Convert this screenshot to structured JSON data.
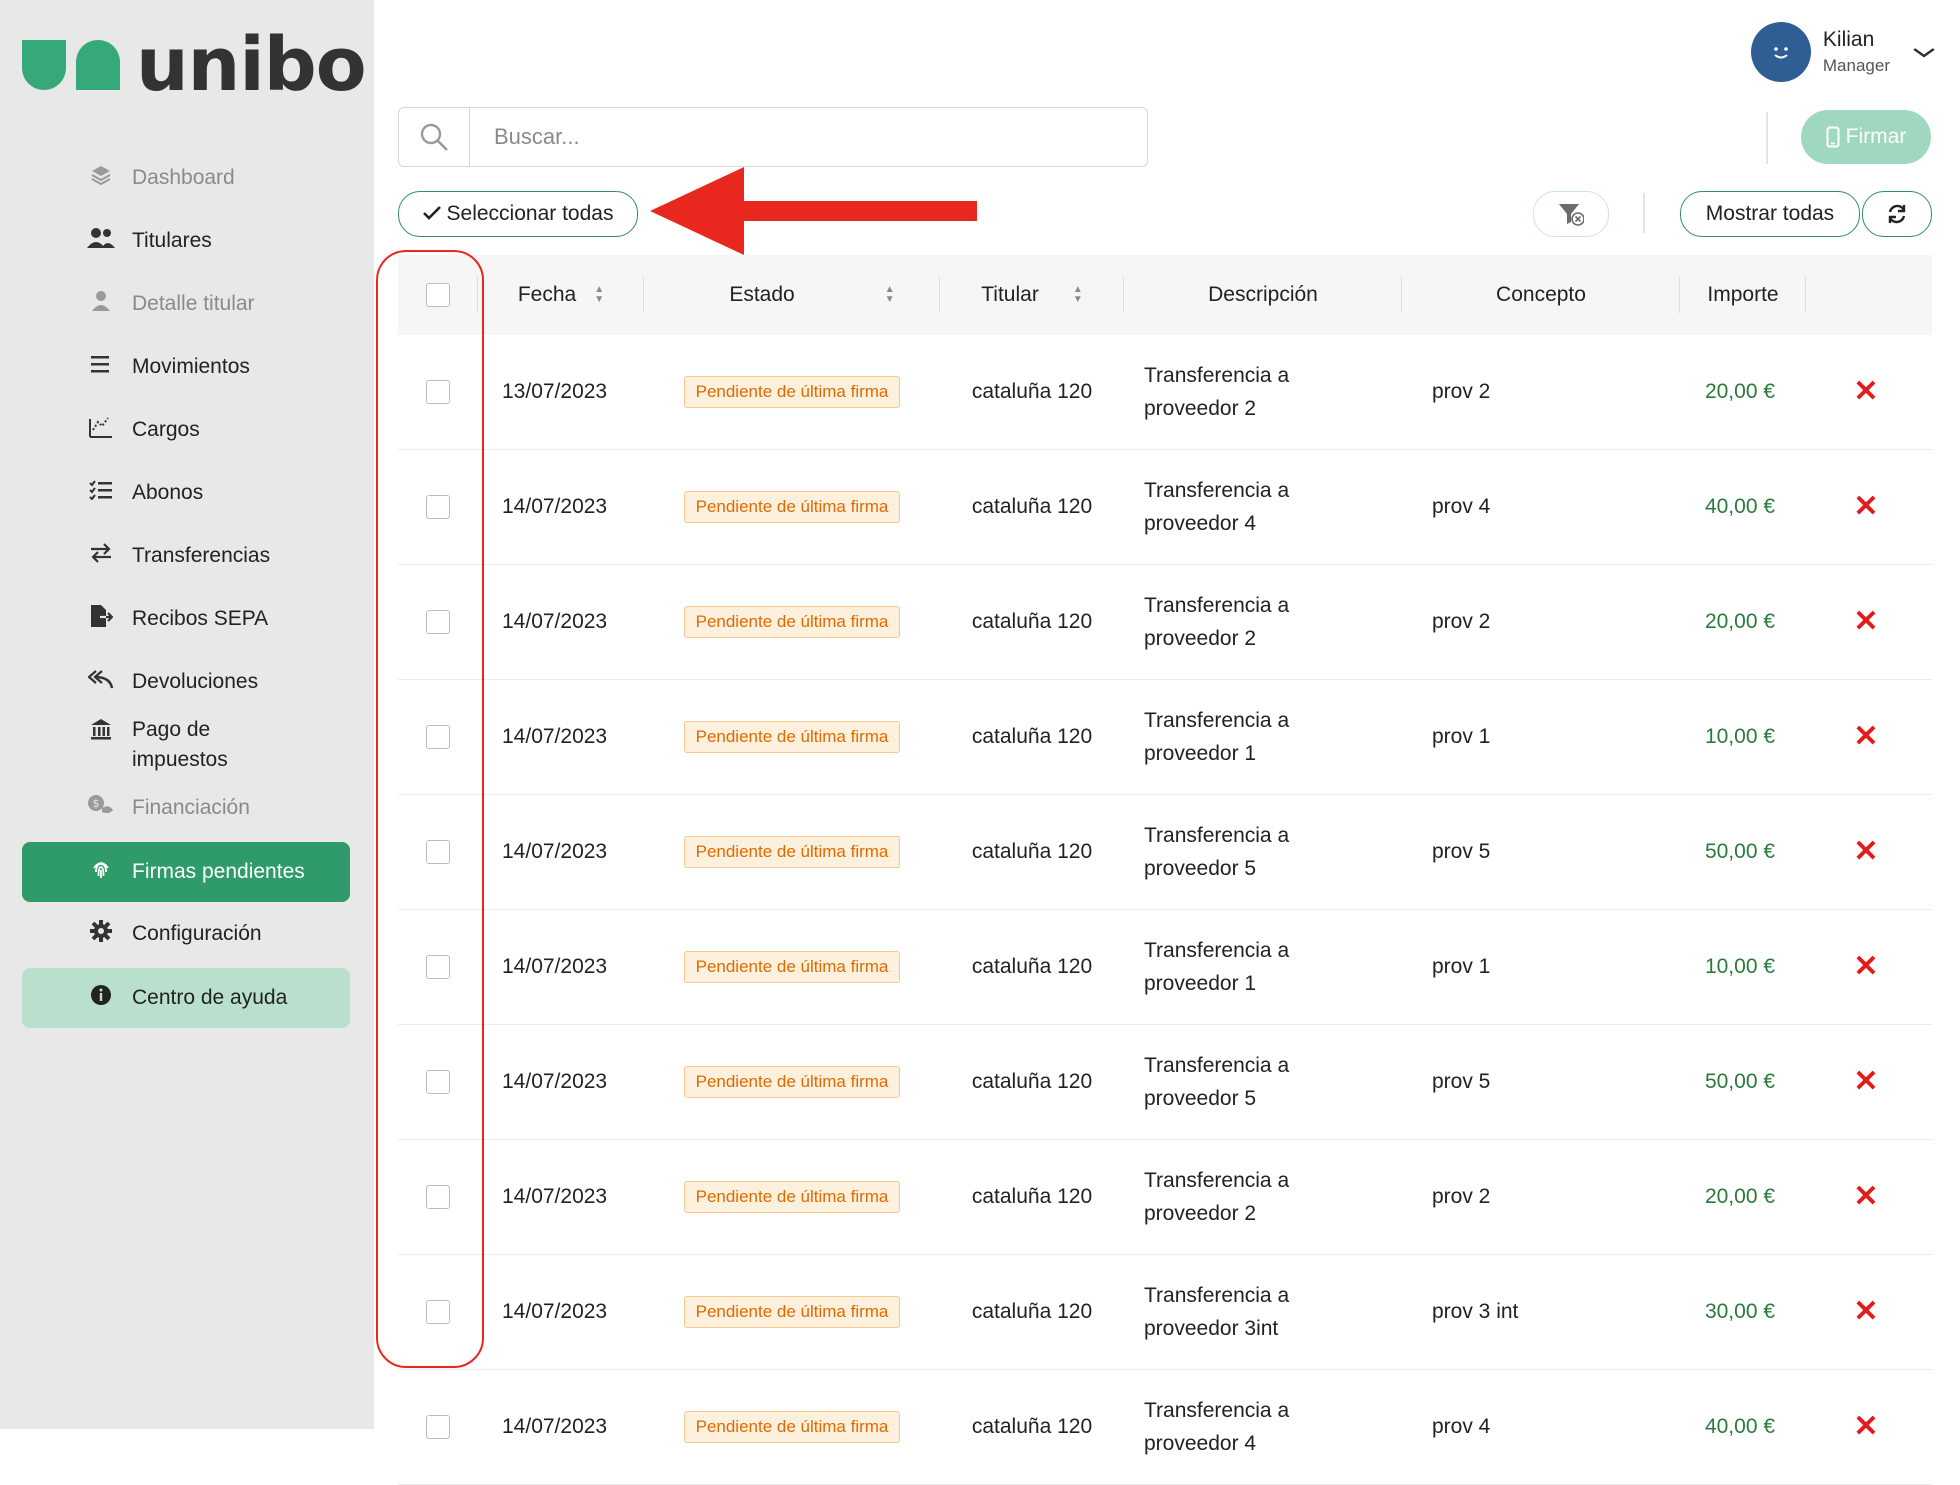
{
  "brand": {
    "name": "unibo"
  },
  "colors": {
    "accent": "#2f9b6a",
    "danger": "#e21b1b",
    "badge_text": "#e06a00",
    "amount": "#2a7a3c"
  },
  "sidebar": {
    "items": [
      {
        "label": "Dashboard",
        "icon": "layers-icon",
        "muted": true
      },
      {
        "label": "Titulares",
        "icon": "users-icon",
        "muted": false
      },
      {
        "label": "Detalle titular",
        "icon": "user-icon",
        "muted": true
      },
      {
        "label": "Movimientos",
        "icon": "list-icon",
        "muted": false
      },
      {
        "label": "Cargos",
        "icon": "chart-icon",
        "muted": false
      },
      {
        "label": "Abonos",
        "icon": "checklist-icon",
        "muted": false
      },
      {
        "label": "Transferencias",
        "icon": "transfer-icon",
        "muted": false
      },
      {
        "label": "Recibos SEPA",
        "icon": "file-export-icon",
        "muted": false
      },
      {
        "label": "Devoluciones",
        "icon": "reply-all-icon",
        "muted": false
      },
      {
        "label": "Pago de impuestos",
        "icon": "bank-icon",
        "muted": false
      },
      {
        "label": "Financiación",
        "icon": "coins-icon",
        "muted": true
      },
      {
        "label": "Firmas pendientes",
        "icon": "fingerprint-icon",
        "active": true
      },
      {
        "label": "Configuración",
        "icon": "gear-icon",
        "muted": false
      },
      {
        "label": "Centro de ayuda",
        "icon": "info-icon",
        "help": true
      }
    ]
  },
  "user": {
    "name": "Kilian",
    "role": "Manager"
  },
  "search": {
    "placeholder": "Buscar..."
  },
  "toolbar": {
    "firmar_label": "Firmar",
    "select_all_label": "Seleccionar todas",
    "show_all_label": "Mostrar todas"
  },
  "table": {
    "columns": [
      "Fecha",
      "Estado",
      "Titular",
      "Descripción",
      "Concepto",
      "Importe"
    ],
    "rows": [
      {
        "fecha": "13/07/2023",
        "estado": "Pendiente de última firma",
        "titular": "cataluña 120",
        "desc1": "Transferencia a",
        "desc2": "proveedor 2",
        "concepto": "prov 2",
        "importe": "20,00 €"
      },
      {
        "fecha": "14/07/2023",
        "estado": "Pendiente de última firma",
        "titular": "cataluña 120",
        "desc1": "Transferencia a",
        "desc2": "proveedor 4",
        "concepto": "prov 4",
        "importe": "40,00 €"
      },
      {
        "fecha": "14/07/2023",
        "estado": "Pendiente de última firma",
        "titular": "cataluña 120",
        "desc1": "Transferencia a",
        "desc2": "proveedor 2",
        "concepto": "prov 2",
        "importe": "20,00 €"
      },
      {
        "fecha": "14/07/2023",
        "estado": "Pendiente de última firma",
        "titular": "cataluña 120",
        "desc1": "Transferencia a",
        "desc2": "proveedor 1",
        "concepto": "prov 1",
        "importe": "10,00 €"
      },
      {
        "fecha": "14/07/2023",
        "estado": "Pendiente de última firma",
        "titular": "cataluña 120",
        "desc1": "Transferencia a",
        "desc2": "proveedor 5",
        "concepto": "prov 5",
        "importe": "50,00 €"
      },
      {
        "fecha": "14/07/2023",
        "estado": "Pendiente de última firma",
        "titular": "cataluña 120",
        "desc1": "Transferencia a",
        "desc2": "proveedor 1",
        "concepto": "prov 1",
        "importe": "10,00 €"
      },
      {
        "fecha": "14/07/2023",
        "estado": "Pendiente de última firma",
        "titular": "cataluña 120",
        "desc1": "Transferencia a",
        "desc2": "proveedor 5",
        "concepto": "prov 5",
        "importe": "50,00 €"
      },
      {
        "fecha": "14/07/2023",
        "estado": "Pendiente de última firma",
        "titular": "cataluña 120",
        "desc1": "Transferencia a",
        "desc2": "proveedor 2",
        "concepto": "prov 2",
        "importe": "20,00 €"
      },
      {
        "fecha": "14/07/2023",
        "estado": "Pendiente de última firma",
        "titular": "cataluña 120",
        "desc1": "Transferencia a",
        "desc2": "proveedor 3int",
        "concepto": "prov 3 int",
        "importe": "30,00 €"
      },
      {
        "fecha": "14/07/2023",
        "estado": "Pendiente de última firma",
        "titular": "cataluña 120",
        "desc1": "Transferencia a",
        "desc2": "proveedor 4",
        "concepto": "prov 4",
        "importe": "40,00 €"
      }
    ]
  }
}
